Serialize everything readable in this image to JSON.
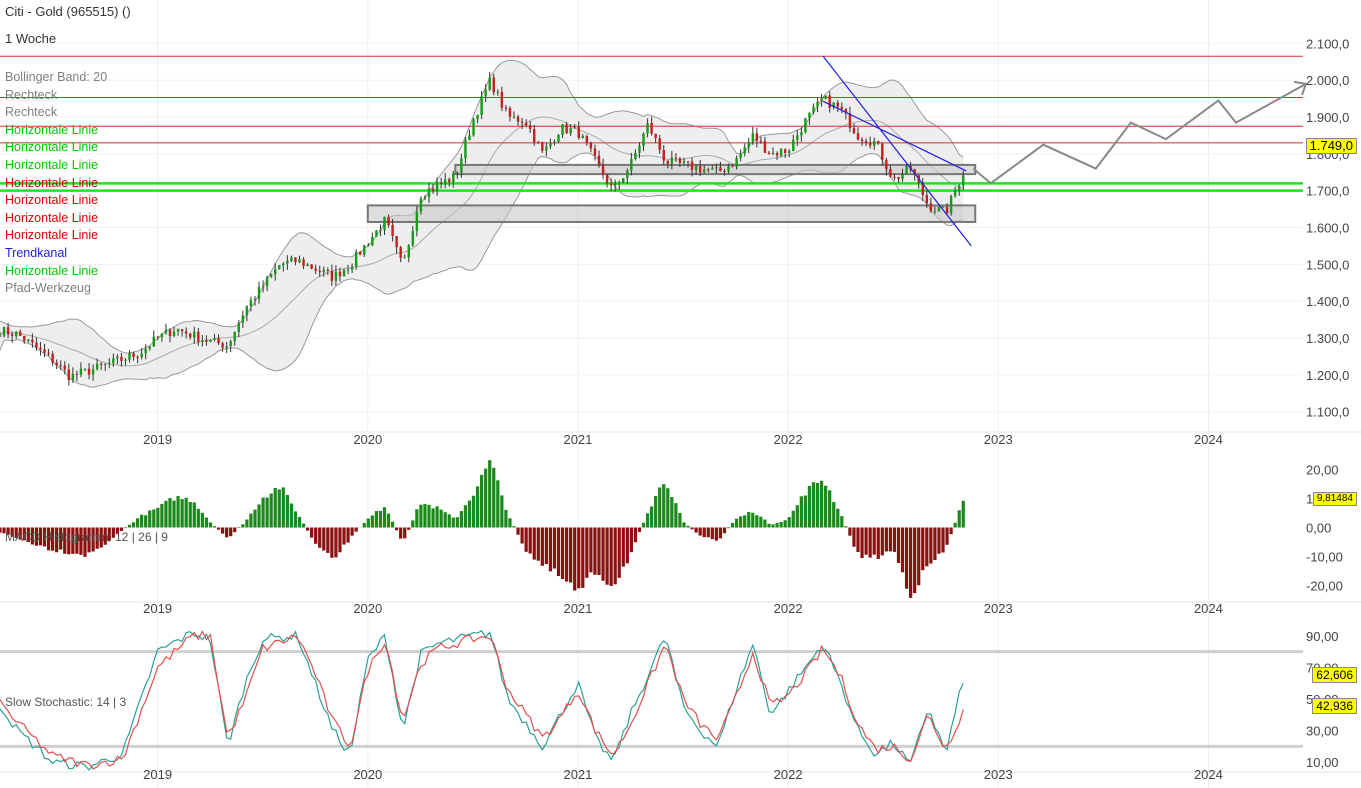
{
  "header": {
    "title": "Citi - Gold (965515) ()",
    "interval": "1 Woche"
  },
  "legend": [
    {
      "label": "Bollinger Band: 20",
      "color": "#808080"
    },
    {
      "label": "Rechteck",
      "color": "#808080"
    },
    {
      "label": "Rechteck",
      "color": "#808080"
    },
    {
      "label": "Horizontale Linie",
      "color": "#00c800"
    },
    {
      "label": "Horizontale Linie",
      "color": "#00c800"
    },
    {
      "label": "Horizontale Linie",
      "color": "#00c800"
    },
    {
      "label": "Horizontale Linie",
      "color": "#e00000"
    },
    {
      "label": "Horizontale Linie",
      "color": "#e00000"
    },
    {
      "label": "Horizontale Linie",
      "color": "#e00000"
    },
    {
      "label": "Horizontale Linie",
      "color": "#e00000"
    },
    {
      "label": "Trendkanal",
      "color": "#2020e0"
    },
    {
      "label": "Horizontale Linie",
      "color": "#00c800"
    },
    {
      "label": "Pfad-Werkzeug",
      "color": "#808080"
    }
  ],
  "macd_label": "MACD Histogramm: 12 | 26 | 9",
  "stoch_label": "Slow Stochastic: 14 | 3",
  "chart_data": [
    {
      "type": "candlestick",
      "x_range": [
        "2018-03",
        "2024-06"
      ],
      "x_ticks": [
        "2019",
        "2020",
        "2021",
        "2022",
        "2023",
        "2024"
      ],
      "y_range": [
        1050,
        2150
      ],
      "y_ticks": [
        "1.100,0",
        "1.200,0",
        "1.300,0",
        "1.400,0",
        "1.500,0",
        "1.600,0",
        "1.700,0",
        "1.800,0",
        "1.900,0",
        "2.000,0",
        "2.100,0"
      ],
      "last_price": "1.749,0",
      "price_path": [
        [
          "2018-03",
          1330
        ],
        [
          "2018-05",
          1310
        ],
        [
          "2018-07",
          1240
        ],
        [
          "2018-08",
          1195
        ],
        [
          "2018-10",
          1225
        ],
        [
          "2018-12",
          1260
        ],
        [
          "2019-01",
          1300
        ],
        [
          "2019-02",
          1325
        ],
        [
          "2019-04",
          1290
        ],
        [
          "2019-05",
          1280
        ],
        [
          "2019-06",
          1380
        ],
        [
          "2019-08",
          1500
        ],
        [
          "2019-09",
          1510
        ],
        [
          "2019-11",
          1465
        ],
        [
          "2019-12",
          1500
        ],
        [
          "2020-01",
          1560
        ],
        [
          "2020-02",
          1620
        ],
        [
          "2020-03",
          1490
        ],
        [
          "2020-04",
          1690
        ],
        [
          "2020-06",
          1740
        ],
        [
          "2020-07",
          1890
        ],
        [
          "2020-08",
          2000
        ],
        [
          "2020-09",
          1900
        ],
        [
          "2020-10",
          1890
        ],
        [
          "2020-11",
          1800
        ],
        [
          "2020-12",
          1870
        ],
        [
          "2021-01",
          1860
        ],
        [
          "2021-03",
          1700
        ],
        [
          "2021-04",
          1770
        ],
        [
          "2021-05",
          1880
        ],
        [
          "2021-06",
          1780
        ],
        [
          "2021-08",
          1760
        ],
        [
          "2021-09",
          1750
        ],
        [
          "2021-10",
          1780
        ],
        [
          "2021-11",
          1850
        ],
        [
          "2021-12",
          1800
        ],
        [
          "2022-01",
          1810
        ],
        [
          "2022-02",
          1890
        ],
        [
          "2022-03",
          1950
        ],
        [
          "2022-04",
          1920
        ],
        [
          "2022-05",
          1850
        ],
        [
          "2022-06",
          1830
        ],
        [
          "2022-07",
          1730
        ],
        [
          "2022-08",
          1760
        ],
        [
          "2022-09",
          1660
        ],
        [
          "2022-10",
          1640
        ],
        [
          "2022-11",
          1749
        ]
      ],
      "horizontal_lines_red": [
        2065,
        1953,
        1875,
        1830
      ],
      "horizontal_lines_green": [
        1720,
        1700
      ],
      "rectangles": [
        {
          "from": "2020-06",
          "to": "2022-11",
          "low": 1745,
          "high": 1770
        },
        {
          "from": "2020-01",
          "to": "2022-11",
          "low": 1615,
          "high": 1660
        }
      ],
      "trend_channel": {
        "from": [
          "2022-03",
          2065
        ],
        "to": [
          "2022-11",
          1550
        ]
      },
      "path_tool": [
        [
          "2022-11",
          1760
        ],
        [
          "2022-12",
          1720
        ],
        [
          "2023-03",
          1825
        ],
        [
          "2023-06",
          1760
        ],
        [
          "2023-08",
          1885
        ],
        [
          "2023-10",
          1840
        ],
        [
          "2024-01",
          1945
        ],
        [
          "2024-02",
          1885
        ],
        [
          "2024-06",
          1990
        ]
      ]
    },
    {
      "type": "bar",
      "name": "MACD Histogramm: 12 | 26 | 9",
      "y_range": [
        -25,
        25
      ],
      "y_ticks": [
        "-20,00",
        "-10,00",
        "0,00",
        "10,00",
        "20,00"
      ],
      "last_value": "9,81484",
      "values_by_date": [
        [
          "2018-03",
          0.5
        ],
        [
          "2018-05",
          -4
        ],
        [
          "2018-07",
          -8
        ],
        [
          "2018-09",
          -10
        ],
        [
          "2018-10",
          -6
        ],
        [
          "2018-12",
          4
        ],
        [
          "2019-01",
          7
        ],
        [
          "2019-02",
          11
        ],
        [
          "2019-03",
          10
        ],
        [
          "2019-04",
          2
        ],
        [
          "2019-05",
          -4
        ],
        [
          "2019-06",
          2
        ],
        [
          "2019-07",
          11
        ],
        [
          "2019-08",
          15
        ],
        [
          "2019-09",
          5
        ],
        [
          "2019-10",
          -6
        ],
        [
          "2019-11",
          -12
        ],
        [
          "2019-12",
          -4
        ],
        [
          "2020-01",
          3
        ],
        [
          "2020-02",
          8
        ],
        [
          "2020-03",
          -6
        ],
        [
          "2020-04",
          9
        ],
        [
          "2020-05",
          7
        ],
        [
          "2020-06",
          3
        ],
        [
          "2020-07",
          12
        ],
        [
          "2020-08",
          24
        ],
        [
          "2020-09",
          5
        ],
        [
          "2020-10",
          -8
        ],
        [
          "2020-11",
          -14
        ],
        [
          "2020-12",
          -18
        ],
        [
          "2021-01",
          -24
        ],
        [
          "2021-02",
          -16
        ],
        [
          "2021-03",
          -21
        ],
        [
          "2021-04",
          -10
        ],
        [
          "2021-05",
          6
        ],
        [
          "2021-06",
          18
        ],
        [
          "2021-07",
          2
        ],
        [
          "2021-08",
          -3
        ],
        [
          "2021-09",
          -5
        ],
        [
          "2021-10",
          3
        ],
        [
          "2021-11",
          6
        ],
        [
          "2021-12",
          1
        ],
        [
          "2022-01",
          3
        ],
        [
          "2022-02",
          13
        ],
        [
          "2022-03",
          18
        ],
        [
          "2022-04",
          5
        ],
        [
          "2022-05",
          -10
        ],
        [
          "2022-06",
          -11
        ],
        [
          "2022-07",
          -8
        ],
        [
          "2022-08",
          -24
        ],
        [
          "2022-09",
          -14
        ],
        [
          "2022-10",
          -8
        ],
        [
          "2022-11",
          10
        ]
      ]
    },
    {
      "type": "line",
      "name": "Slow Stochastic: 14 | 3",
      "y_range": [
        5,
        100
      ],
      "y_ticks": [
        "10,00",
        "30,00",
        "50,00",
        "70,00",
        "90,00"
      ],
      "reference_lines": [
        20,
        80
      ],
      "last_values": [
        "62,606",
        "42,936"
      ],
      "series": [
        {
          "color": "#2aa198",
          "values_by_date": [
            [
              "2018-03",
              62
            ],
            [
              "2018-05",
              30
            ],
            [
              "2018-07",
              10
            ],
            [
              "2018-09",
              7
            ],
            [
              "2018-11",
              15
            ],
            [
              "2019-01",
              80
            ],
            [
              "2019-03",
              92
            ],
            [
              "2019-04",
              88
            ],
            [
              "2019-05",
              20
            ],
            [
              "2019-06",
              60
            ],
            [
              "2019-07",
              88
            ],
            [
              "2019-09",
              90
            ],
            [
              "2019-10",
              60
            ],
            [
              "2019-11",
              30
            ],
            [
              "2019-12",
              15
            ],
            [
              "2020-01",
              75
            ],
            [
              "2020-02",
              90
            ],
            [
              "2020-03",
              30
            ],
            [
              "2020-04",
              78
            ],
            [
              "2020-05",
              85
            ],
            [
              "2020-07",
              90
            ],
            [
              "2020-08",
              92
            ],
            [
              "2020-09",
              50
            ],
            [
              "2020-11",
              20
            ],
            [
              "2020-12",
              40
            ],
            [
              "2021-01",
              60
            ],
            [
              "2021-02",
              25
            ],
            [
              "2021-03",
              10
            ],
            [
              "2021-04",
              40
            ],
            [
              "2021-06",
              90
            ],
            [
              "2021-07",
              45
            ],
            [
              "2021-08",
              30
            ],
            [
              "2021-09",
              20
            ],
            [
              "2021-10",
              55
            ],
            [
              "2021-11",
              85
            ],
            [
              "2021-12",
              40
            ],
            [
              "2022-01",
              55
            ],
            [
              "2022-02",
              70
            ],
            [
              "2022-03",
              85
            ],
            [
              "2022-04",
              60
            ],
            [
              "2022-05",
              30
            ],
            [
              "2022-06",
              15
            ],
            [
              "2022-07",
              22
            ],
            [
              "2022-08",
              8
            ],
            [
              "2022-09",
              45
            ],
            [
              "2022-10",
              15
            ],
            [
              "2022-11",
              62.6
            ]
          ]
        },
        {
          "color": "#e05050",
          "values_by_date": [
            [
              "2018-03",
              60
            ],
            [
              "2018-05",
              35
            ],
            [
              "2018-07",
              14
            ],
            [
              "2018-09",
              8
            ],
            [
              "2018-11",
              12
            ],
            [
              "2019-01",
              70
            ],
            [
              "2019-03",
              90
            ],
            [
              "2019-04",
              90
            ],
            [
              "2019-05",
              25
            ],
            [
              "2019-06",
              50
            ],
            [
              "2019-07",
              82
            ],
            [
              "2019-09",
              90
            ],
            [
              "2019-10",
              66
            ],
            [
              "2019-11",
              36
            ],
            [
              "2019-12",
              20
            ],
            [
              "2020-01",
              68
            ],
            [
              "2020-02",
              88
            ],
            [
              "2020-03",
              36
            ],
            [
              "2020-04",
              72
            ],
            [
              "2020-05",
              82
            ],
            [
              "2020-07",
              88
            ],
            [
              "2020-08",
              90
            ],
            [
              "2020-09",
              56
            ],
            [
              "2020-11",
              25
            ],
            [
              "2020-12",
              38
            ],
            [
              "2021-01",
              56
            ],
            [
              "2021-02",
              30
            ],
            [
              "2021-03",
              14
            ],
            [
              "2021-04",
              34
            ],
            [
              "2021-06",
              85
            ],
            [
              "2021-07",
              50
            ],
            [
              "2021-08",
              34
            ],
            [
              "2021-09",
              24
            ],
            [
              "2021-10",
              50
            ],
            [
              "2021-11",
              80
            ],
            [
              "2021-12",
              45
            ],
            [
              "2022-01",
              52
            ],
            [
              "2022-02",
              66
            ],
            [
              "2022-03",
              82
            ],
            [
              "2022-04",
              64
            ],
            [
              "2022-05",
              34
            ],
            [
              "2022-06",
              18
            ],
            [
              "2022-07",
              20
            ],
            [
              "2022-08",
              12
            ],
            [
              "2022-09",
              40
            ],
            [
              "2022-10",
              18
            ],
            [
              "2022-11",
              42.9
            ]
          ]
        }
      ]
    }
  ]
}
